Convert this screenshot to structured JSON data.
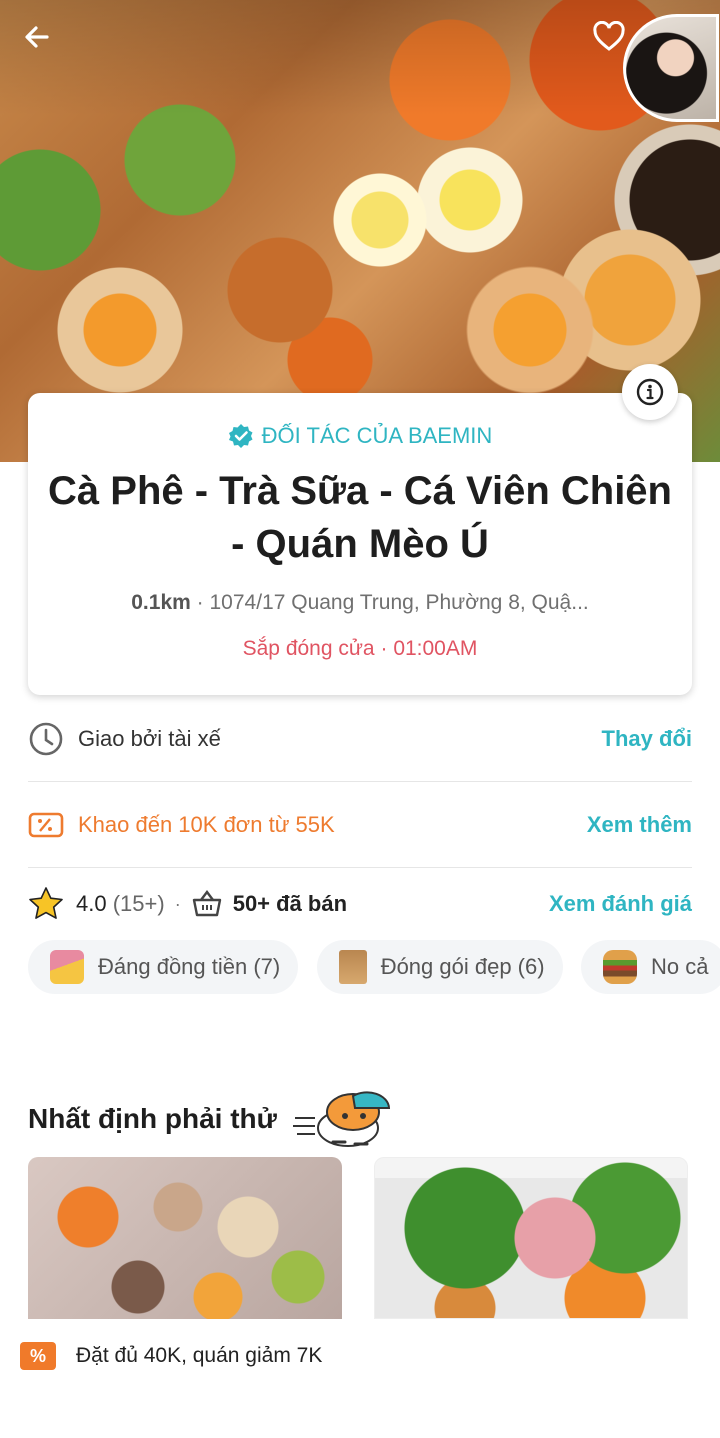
{
  "header": {
    "back_icon": "arrow-left-icon",
    "favorite_icon": "heart-icon"
  },
  "store": {
    "partner_label": "ĐỐI TÁC CỦA BAEMIN",
    "name": "Cà Phê - Trà Sữa - Cá Viên Chiên - Quán Mèo Ú",
    "distance": "0.1km",
    "separator": "·",
    "address": "1074/17 Quang Trung, Phường 8, Quậ...",
    "closing_status": "Sắp đóng cửa",
    "closing_time": "01:00AM"
  },
  "delivery": {
    "label": "Giao bởi tài xế",
    "action": "Thay đổi"
  },
  "promo": {
    "label": "Khao đến 10K đơn từ 55K",
    "action": "Xem thêm"
  },
  "rating": {
    "score": "4.0",
    "count": "(15+)",
    "sold": "50+ đã bán",
    "action": "Xem đánh giá"
  },
  "review_tags": [
    {
      "label": "Đáng đồng tiền (7)",
      "icon": "money-emoji-icon"
    },
    {
      "label": "Đóng gói đẹp (6)",
      "icon": "paper-bag-emoji-icon"
    },
    {
      "label": "No cả",
      "icon": "burger-emoji-icon"
    }
  ],
  "must_try": {
    "title": "Nhất định phải thử",
    "promo_text": "Đặt đủ 40K, quán giảm 7K",
    "promo_tag": "%"
  },
  "colors": {
    "accent": "#2fb5c2",
    "promo": "#ee7b2f",
    "closing": "#e05462"
  }
}
